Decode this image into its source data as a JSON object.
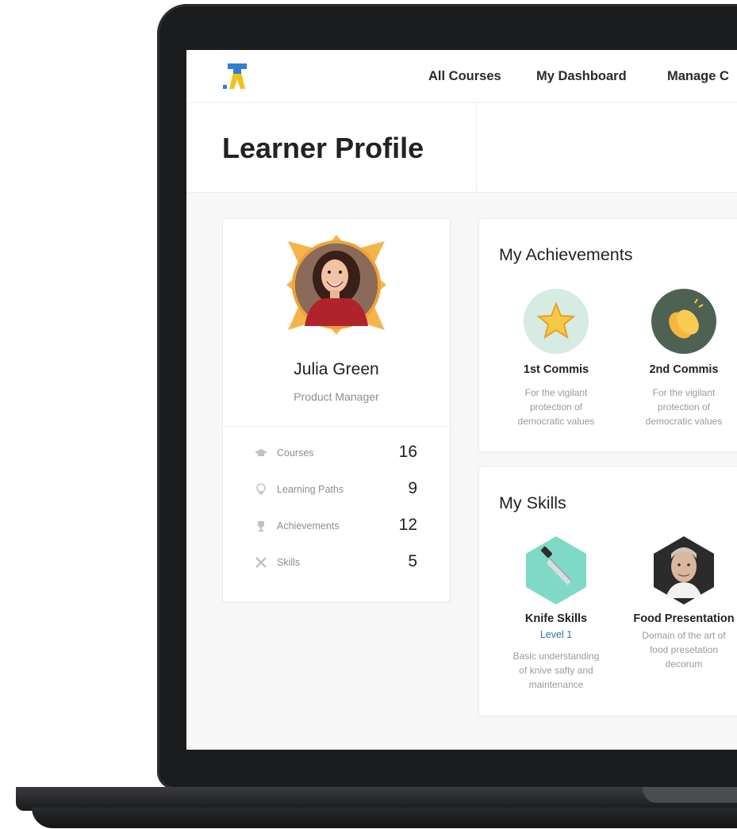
{
  "nav": {
    "links": [
      "All Courses",
      "My Dashboard",
      "Manage C"
    ]
  },
  "page": {
    "title": "Learner Profile"
  },
  "profile": {
    "name": "Julia Green",
    "role": "Product Manager",
    "stats": [
      {
        "label": "Courses",
        "value": "16",
        "icon": "graduation-cap-icon"
      },
      {
        "label": "Learning Paths",
        "value": "9",
        "icon": "lightbulb-icon"
      },
      {
        "label": "Achievements",
        "value": "12",
        "icon": "trophy-icon"
      },
      {
        "label": "Skills",
        "value": "5",
        "icon": "tools-icon"
      }
    ]
  },
  "achievements": {
    "title": "My Achievements",
    "items": [
      {
        "title": "1st Commis",
        "desc": [
          "For the vigilant",
          "protection of",
          "democratic values"
        ],
        "icon": "star-icon"
      },
      {
        "title": "2nd Commis",
        "desc": [
          "For the vigilant",
          "protection of",
          "democratic values"
        ],
        "icon": "clapping-hands-icon"
      }
    ]
  },
  "skills": {
    "title": "My Skills",
    "items": [
      {
        "title": "Knife Skills",
        "level": "Level 1",
        "desc": [
          "Basic understanding",
          "of knive safty and",
          "maintenance"
        ],
        "icon": "knife-icon"
      },
      {
        "title": "Food Presentation",
        "desc": [
          "Domain of the art of",
          "food presetation",
          "decorum"
        ],
        "icon": "chef-portrait"
      }
    ]
  },
  "colors": {
    "accent_blue": "#2f6fae",
    "avatar_ring": "#f0a23a",
    "achievement_star_bg": "#d6ebe2",
    "achievement_clap_bg": "#4d6252",
    "skill_knife_bg": "#7fd9c7"
  }
}
